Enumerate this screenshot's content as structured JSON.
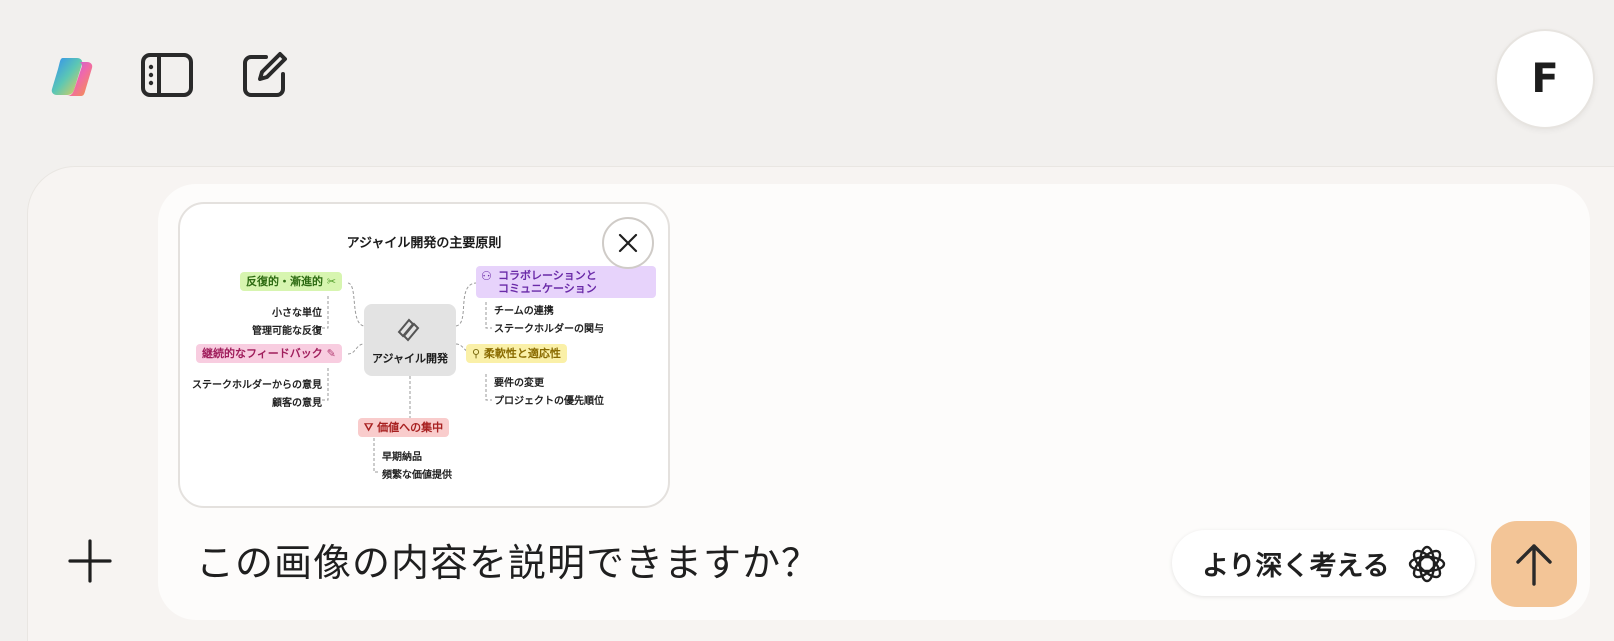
{
  "header": {
    "icons": [
      "copilot-logo",
      "sidebar-toggle-icon",
      "new-chat-icon"
    ],
    "avatar_initial": "F"
  },
  "attachment": {
    "title": "アジャイル開発の主要原則",
    "center_label": "アジャイル開発",
    "nodes": [
      {
        "label": "反復的・漸進的",
        "items": [
          "小さな単位",
          "管理可能な反復"
        ],
        "color": "#d7f5b0"
      },
      {
        "label_lines": [
          "コラボレーションと",
          "コミュニケーション"
        ],
        "items": [
          "チームの連携",
          "ステークホルダーの関与"
        ],
        "color": "#e7d3fb"
      },
      {
        "label": "継続的なフィードバック",
        "items": [
          "ステークホルダーからの意見",
          "顧客の意見"
        ],
        "color": "#f8cde0"
      },
      {
        "label": "柔軟性と適応性",
        "items": [
          "要件の変更",
          "プロジェクトの優先順位"
        ],
        "color": "#faf0a8"
      },
      {
        "label": "価値への集中",
        "items": [
          "早期納品",
          "頻繁な価値提供"
        ],
        "color": "#f9cccc"
      }
    ]
  },
  "composer": {
    "prompt": "この画像の内容を説明できますか？",
    "think_label": "より深く考える"
  },
  "colors": {
    "background": "#f2f0ee",
    "send_button": "#f3c597"
  }
}
